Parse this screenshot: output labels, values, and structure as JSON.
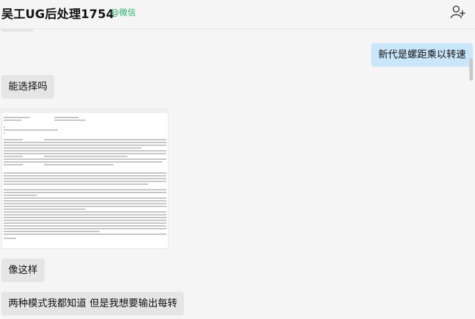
{
  "header": {
    "title": "吴工UG后处理1754",
    "badge": "@微信",
    "add_icon": "add-user-icon"
  },
  "messages": [
    {
      "side": "right",
      "text": "新代是螺距乘以转速"
    },
    {
      "side": "left",
      "text": "能选择吗"
    },
    {
      "side": "left",
      "type": "image",
      "content": "document-screenshot"
    },
    {
      "side": "left",
      "text": "像这样"
    },
    {
      "side": "left",
      "text": "两种模式我都知道   但是我想要输出每转"
    }
  ],
  "colors": {
    "right_bubble": "#c9e6fb",
    "left_bubble": "#e5e5e5",
    "badge": "#2aae67"
  }
}
